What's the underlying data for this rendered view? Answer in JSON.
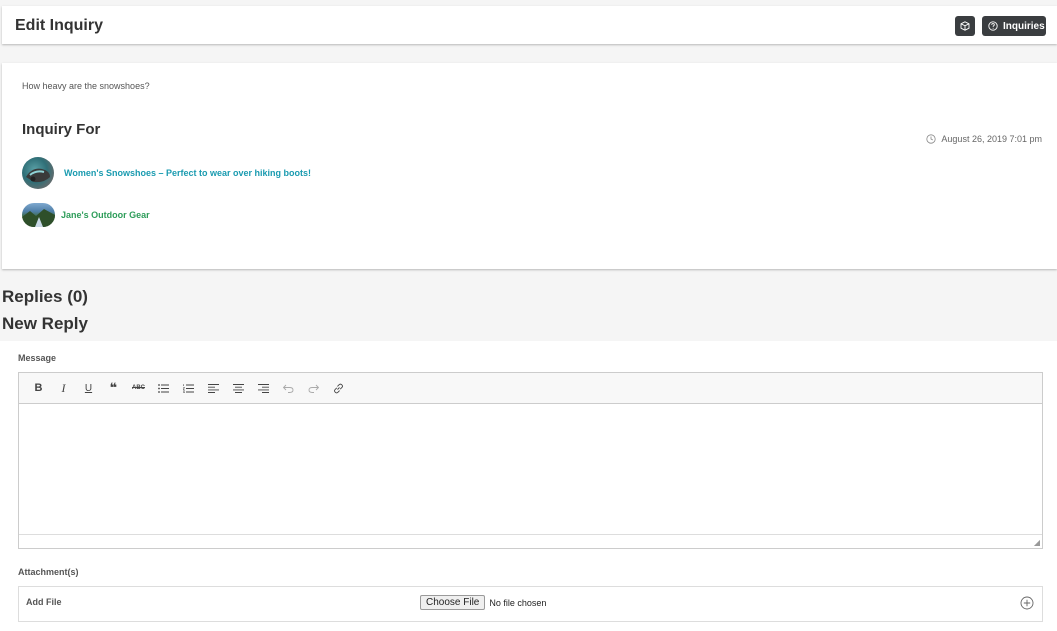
{
  "header": {
    "title": "Edit Inquiry",
    "box_icon": "box-icon",
    "inquiries_button": {
      "label": "Inquiries",
      "icon": "question-circle-icon"
    }
  },
  "inquiry": {
    "question": "How heavy are the snowshoes?",
    "heading": "Inquiry For",
    "date": "August 26, 2019 7:01 pm",
    "date_icon": "clock-icon",
    "product": {
      "name": "Women's Snowshoes – Perfect to wear over hiking boots!",
      "color": "#1a9bb0"
    },
    "store": {
      "name": "Jane's Outdoor Gear",
      "color": "#2e9d5a"
    }
  },
  "replies_title": "Replies (0)",
  "new_reply_title": "New Reply",
  "form": {
    "message_label": "Message",
    "toolbar": [
      {
        "name": "bold-button",
        "glyph": "B"
      },
      {
        "name": "italic-button",
        "glyph": "I"
      },
      {
        "name": "underline-button",
        "glyph": "U"
      },
      {
        "name": "blockquote-button",
        "glyph": "❝"
      },
      {
        "name": "strikethrough-button",
        "glyph": "ABC"
      },
      {
        "name": "bullet-list-button",
        "glyph": "list"
      },
      {
        "name": "numbered-list-button",
        "glyph": "numlist"
      },
      {
        "name": "align-left-button",
        "glyph": "left"
      },
      {
        "name": "align-center-button",
        "glyph": "center"
      },
      {
        "name": "align-right-button",
        "glyph": "right"
      },
      {
        "name": "undo-button",
        "glyph": "↶"
      },
      {
        "name": "redo-button",
        "glyph": "↷"
      },
      {
        "name": "link-button",
        "glyph": "link"
      }
    ],
    "attachments_label": "Attachment(s)",
    "add_file_label": "Add File",
    "choose_file_label": "Choose File",
    "no_file_text": "No file chosen",
    "add_icon": "plus-circle-icon"
  }
}
